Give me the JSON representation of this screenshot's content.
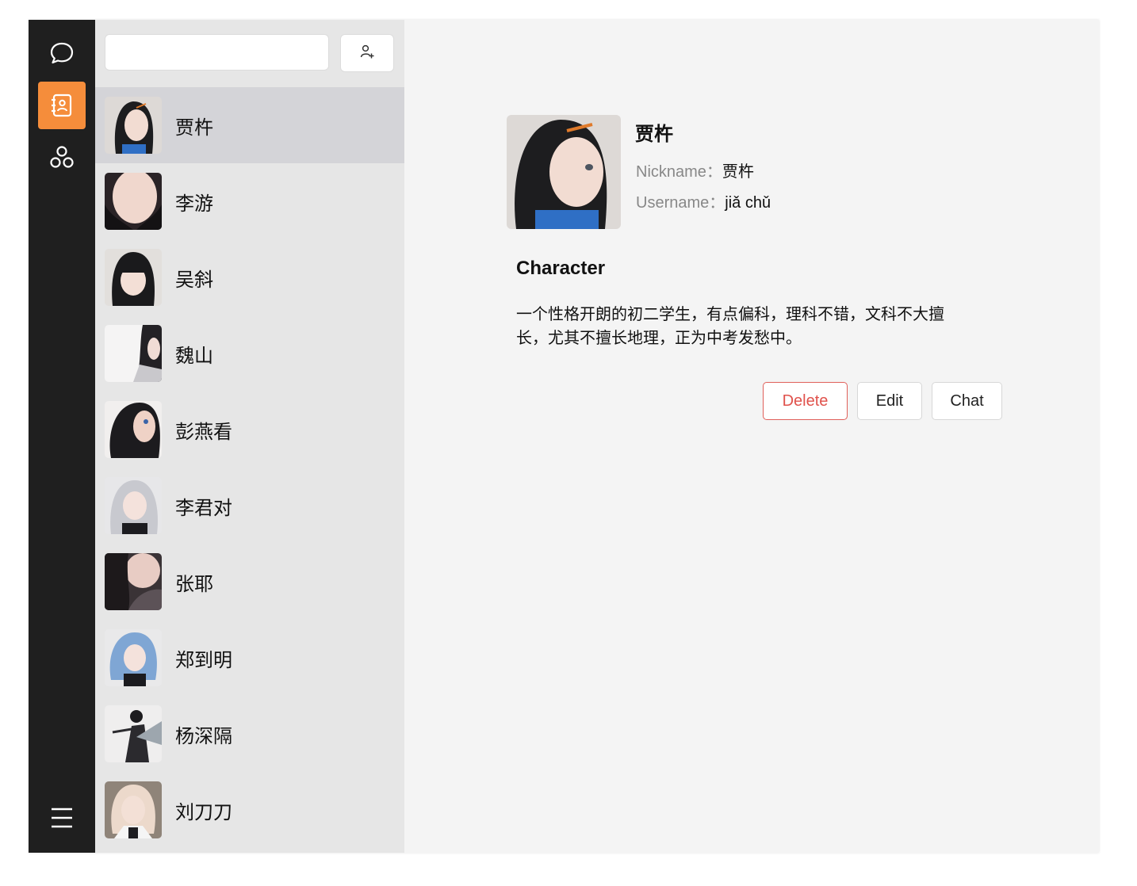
{
  "nav": {
    "items": [
      {
        "icon": "chat-bubble-icon",
        "active": false
      },
      {
        "icon": "contacts-book-icon",
        "active": true
      },
      {
        "icon": "groups-icon",
        "active": false
      }
    ],
    "menu_icon": "hamburger-menu-icon",
    "accent": "#f58d3b"
  },
  "search": {
    "value": "",
    "placeholder": ""
  },
  "add_contact_icon": "add-user-icon",
  "contacts": [
    {
      "name": "贾杵",
      "selected": true
    },
    {
      "name": "李游"
    },
    {
      "name": "吴斜"
    },
    {
      "name": "魏山"
    },
    {
      "name": "彭燕看"
    },
    {
      "name": "李君对"
    },
    {
      "name": "张耶"
    },
    {
      "name": "郑到明"
    },
    {
      "name": "杨深隔"
    },
    {
      "name": "刘刀刀"
    }
  ],
  "profile": {
    "name": "贾杵",
    "nickname_label": "Nickname：",
    "nickname": "贾杵",
    "username_label": "Username：",
    "username": "jiǎ chǔ"
  },
  "character": {
    "title": "Character",
    "text": "一个性格开朗的初二学生，有点偏科，理科不错，文科不大擅长，尤其不擅长地理，正为中考发愁中。"
  },
  "actions": {
    "delete": "Delete",
    "edit": "Edit",
    "chat": "Chat",
    "danger_color": "#e0524c"
  }
}
